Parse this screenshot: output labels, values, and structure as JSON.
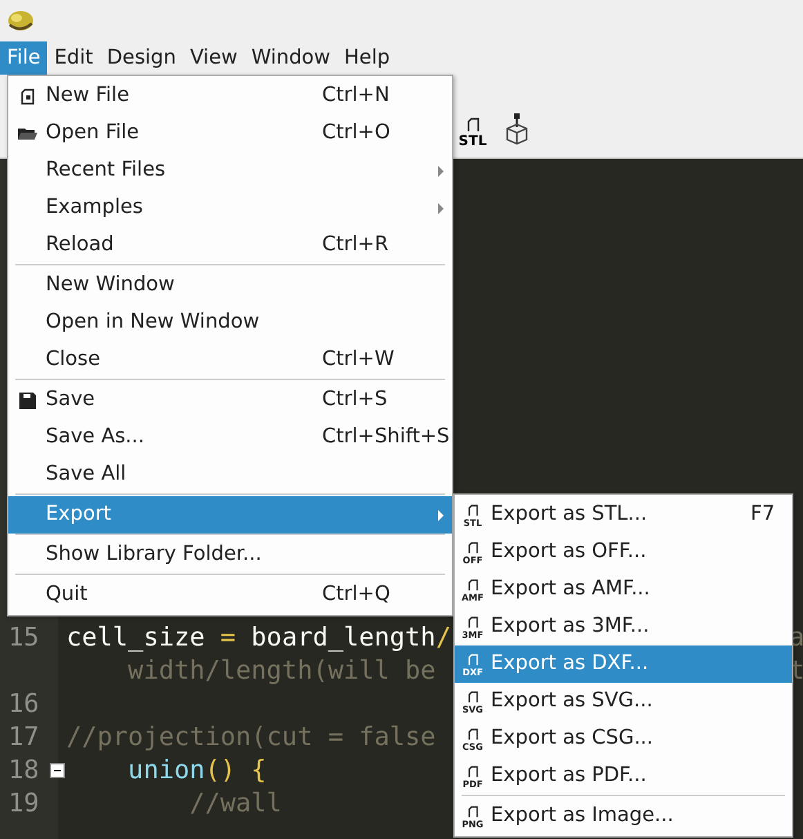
{
  "menubar": [
    {
      "label": "File",
      "selected": true
    },
    {
      "label": "Edit",
      "selected": false
    },
    {
      "label": "Design",
      "selected": false
    },
    {
      "label": "View",
      "selected": false
    },
    {
      "label": "Window",
      "selected": false
    },
    {
      "label": "Help",
      "selected": false
    }
  ],
  "toolbar": [
    {
      "kind": "stl",
      "icon_label": "STL"
    },
    {
      "kind": "cube"
    }
  ],
  "editor": {
    "lines": [
      {
        "number": "15",
        "tokens": [
          {
            "kind": "ident",
            "text": "cell_size "
          },
          {
            "kind": "op",
            "text": "="
          },
          {
            "kind": "ident",
            "text": " board_length"
          },
          {
            "kind": "op",
            "text": "/"
          }
        ],
        "right_fragment": "a"
      },
      {
        "tokens": [
          {
            "kind": "comment",
            "text": "    width/length(will be"
          }
        ],
        "right_fragment": "t"
      },
      {
        "number": "16"
      },
      {
        "number": "17",
        "tokens": [
          {
            "kind": "comment",
            "text": "//projection(cut = false"
          }
        ]
      },
      {
        "number": "18",
        "expanded": true,
        "tokens": [
          {
            "kind": "keyword",
            "text": "    union"
          },
          {
            "kind": "op",
            "text": "() {"
          }
        ]
      },
      {
        "number": "19",
        "tokens": [
          {
            "kind": "comment",
            "text": "        //wall"
          }
        ]
      }
    ]
  },
  "file_menu": [
    {
      "kind": "new_file",
      "label": "New File",
      "shortcut": "Ctrl+N",
      "selected": false
    },
    {
      "kind": "open_file",
      "label": "Open File",
      "shortcut": "Ctrl+O",
      "selected": false
    },
    {
      "kind": "submenu",
      "label": "Recent Files",
      "selected": false
    },
    {
      "kind": "submenu",
      "label": "Examples",
      "selected": false
    },
    {
      "kind": "item",
      "label": "Reload",
      "shortcut": "Ctrl+R",
      "selected": false
    },
    {
      "kind": "separator"
    },
    {
      "kind": "item",
      "label": "New Window",
      "selected": false
    },
    {
      "kind": "item",
      "label": "Open in New Window",
      "selected": false
    },
    {
      "kind": "item",
      "label": "Close",
      "shortcut": "Ctrl+W",
      "selected": false
    },
    {
      "kind": "separator"
    },
    {
      "kind": "save",
      "label": "Save",
      "shortcut": "Ctrl+S",
      "selected": false
    },
    {
      "kind": "item",
      "label": "Save As...",
      "shortcut": "Ctrl+Shift+S",
      "selected": false
    },
    {
      "kind": "item",
      "label": "Save All",
      "selected": false
    },
    {
      "kind": "separator"
    },
    {
      "kind": "submenu",
      "label": "Export",
      "selected": true
    },
    {
      "kind": "separator"
    },
    {
      "kind": "item",
      "label": "Show Library Folder...",
      "selected": false
    },
    {
      "kind": "separator"
    },
    {
      "kind": "item",
      "label": "Quit",
      "shortcut": "Ctrl+Q",
      "selected": false
    }
  ],
  "export_menu": [
    {
      "kind": "item",
      "icon_label": "STL",
      "label": "Export as STL...",
      "shortcut": "F7",
      "selected": false
    },
    {
      "kind": "item",
      "icon_label": "OFF",
      "label": "Export as OFF...",
      "selected": false
    },
    {
      "kind": "item",
      "icon_label": "AMF",
      "label": "Export as AMF...",
      "selected": false
    },
    {
      "kind": "item",
      "icon_label": "3MF",
      "label": "Export as 3MF...",
      "selected": false
    },
    {
      "kind": "item",
      "icon_label": "DXF",
      "label": "Export as DXF...",
      "selected": true
    },
    {
      "kind": "item",
      "icon_label": "SVG",
      "label": "Export as SVG...",
      "selected": false
    },
    {
      "kind": "item",
      "icon_label": "CSG",
      "label": "Export as CSG...",
      "selected": false
    },
    {
      "kind": "item",
      "icon_label": "PDF",
      "label": "Export as PDF...",
      "selected": false
    },
    {
      "kind": "separator"
    },
    {
      "kind": "item",
      "icon_label": "PNG",
      "label": "Export as Image...",
      "selected": false
    }
  ]
}
